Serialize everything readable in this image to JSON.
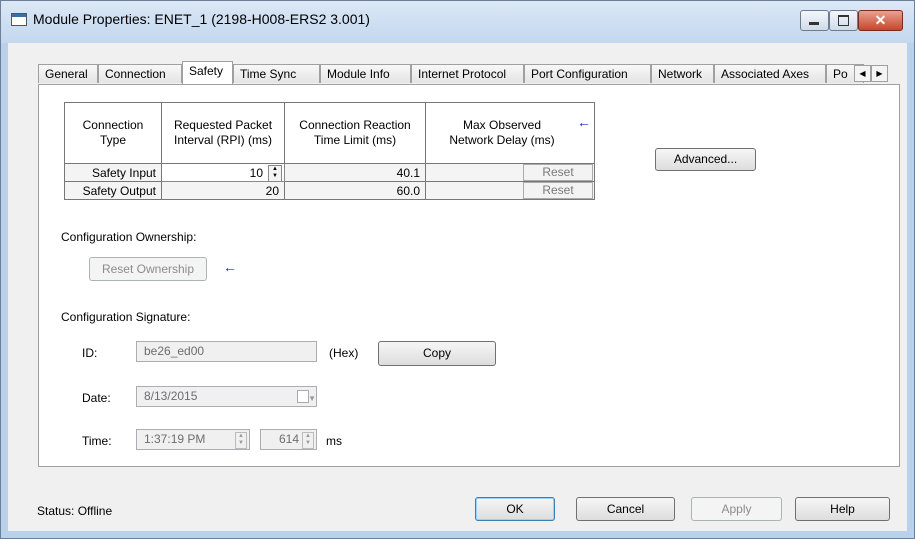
{
  "window": {
    "title": "Module Properties: ENET_1 (2198-H008-ERS2 3.001)",
    "close_glyph": "✕"
  },
  "tabs": [
    {
      "label": "General"
    },
    {
      "label": "Connection"
    },
    {
      "label": "Safety"
    },
    {
      "label": "Time Sync"
    },
    {
      "label": "Module Info"
    },
    {
      "label": "Internet Protocol"
    },
    {
      "label": "Port Configuration"
    },
    {
      "label": "Network"
    },
    {
      "label": "Associated Axes"
    },
    {
      "label": "Po"
    }
  ],
  "active_tab": "Safety",
  "tab_scroll": {
    "left": "◀",
    "right": "▶"
  },
  "table": {
    "headers": {
      "type": "Connection\nType",
      "rpi": "Requested Packet\nInterval (RPI) (ms)",
      "reaction": "Connection Reaction\nTime Limit (ms)",
      "delay": "Max Observed\nNetwork Delay (ms)"
    },
    "rows": [
      {
        "type": "Safety Input",
        "rpi": "10",
        "reaction": "40.1",
        "delay": "",
        "reset": "Reset"
      },
      {
        "type": "Safety Output",
        "rpi": "20",
        "reaction": "60.0",
        "delay": "",
        "reset": "Reset"
      }
    ]
  },
  "advanced_label": "Advanced...",
  "ownership": {
    "heading": "Configuration Ownership:",
    "reset_label": "Reset Ownership"
  },
  "signature": {
    "heading": "Configuration Signature:",
    "id_label": "ID:",
    "id_value": "be26_ed00",
    "hex_label": "(Hex)",
    "copy_label": "Copy",
    "date_label": "Date:",
    "date_value": "8/13/2015",
    "time_label": "Time:",
    "time_value": "1:37:19 PM",
    "ms_value": "614",
    "ms_label": "ms"
  },
  "arrow_glyph": "←",
  "status": {
    "text": "Status:  Offline"
  },
  "footer": {
    "ok": "OK",
    "cancel": "Cancel",
    "apply": "Apply",
    "help": "Help"
  }
}
